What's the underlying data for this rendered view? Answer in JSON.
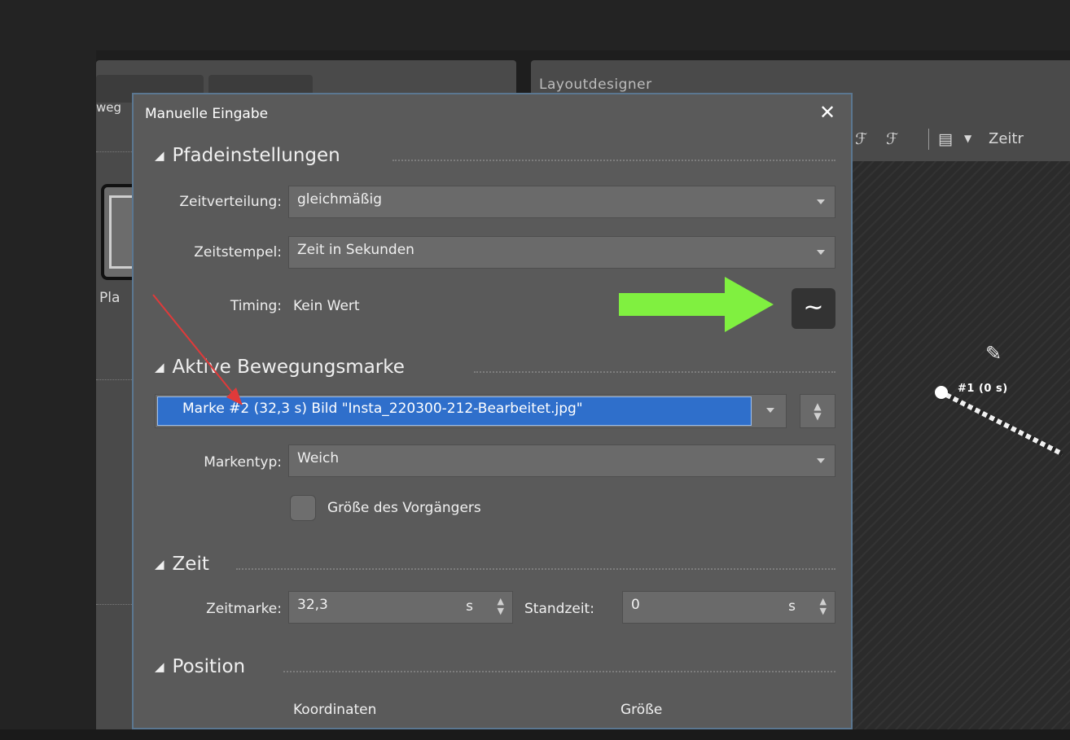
{
  "left_panel": {
    "tab_partial_label": "weg",
    "item_partial_label": "Pla"
  },
  "right_panel": {
    "title": "Layoutdesigner",
    "toolbar": {
      "partial_label": "Zeitr"
    },
    "canvas": {
      "marker_label": "#1 (0 s)"
    }
  },
  "dialog": {
    "title": "Manuelle Eingabe",
    "close_glyph": "✕",
    "path_settings": {
      "header": "Pfadeinstellungen",
      "time_distribution": {
        "label": "Zeitverteilung:",
        "value": "gleichmäßig"
      },
      "timestamp": {
        "label": "Zeitstempel:",
        "value": "Zeit in Sekunden"
      },
      "timing": {
        "label": "Timing:",
        "value": "Kein Wert",
        "button_icon": "wave-icon"
      }
    },
    "active_mark": {
      "header": "Aktive Bewegungsmarke",
      "selected": "Marke #2 (32,3 s) Bild \"Insta_220300-212-Bearbeitet.jpg\"",
      "mark_type": {
        "label": "Markentyp:",
        "value": "Weich"
      },
      "checkbox_label": "Größe des Vorgängers",
      "checkbox_checked": false
    },
    "time": {
      "header": "Zeit",
      "time_mark": {
        "label": "Zeitmarke:",
        "value": "32,3",
        "unit": "s"
      },
      "standing_time": {
        "label": "Standzeit:",
        "value": "0",
        "unit": "s"
      }
    },
    "position": {
      "header": "Position",
      "coordinates_label": "Koordinaten",
      "size_label": "Größe"
    }
  },
  "annotations": {
    "green_arrow_color": "#80f040",
    "red_arrow_color": "#e03a3a"
  },
  "colors": {
    "selection_blue": "#2f6fcb",
    "dialog_bg": "#5a5a5a",
    "dialog_border": "#5b7791"
  }
}
